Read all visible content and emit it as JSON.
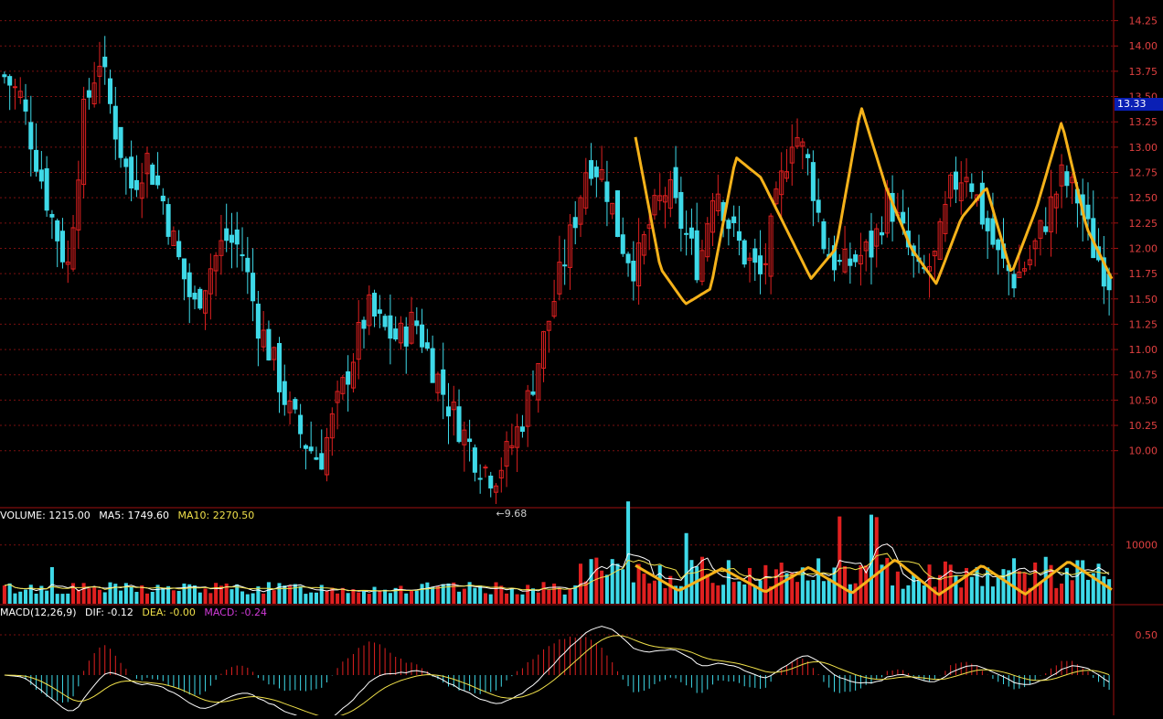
{
  "colors": {
    "up": "#e02020",
    "down": "#3ed9e8",
    "axis": "#a01010",
    "grid": "#7a1010",
    "highlight_line": "#f5b21a",
    "ma5": "#ffffff",
    "ma10": "#f0e04a",
    "macd_label": "#d03ad8",
    "price_tag_bg": "#0a1fb5"
  },
  "price_panel": {
    "current_price_tag": "13.33",
    "low_marker": "9.68",
    "y_ticks": [
      "14.25",
      "14.00",
      "13.75",
      "13.50",
      "13.25",
      "13.00",
      "12.75",
      "12.50",
      "12.25",
      "12.00",
      "11.75",
      "11.50",
      "11.25",
      "11.00",
      "10.75",
      "10.50",
      "10.25",
      "10.00"
    ]
  },
  "volume_panel": {
    "legend": {
      "volume_label": "VOLUME: 1215.00",
      "ma5_label": "MA5: 1749.60",
      "ma10_label": "MA10: 2270.50"
    },
    "y_ticks": [
      "10000"
    ]
  },
  "macd_panel": {
    "legend": {
      "title": "MACD(12,26,9)",
      "dif_label": "DIF: -0.12",
      "dea_label": "DEA: -0.00",
      "macd_label": "MACD: -0.24"
    },
    "y_ticks": [
      "0.50"
    ]
  },
  "chart_data": {
    "type": "candlestick",
    "y_range": [
      9.5,
      14.4
    ],
    "bar_count": 210,
    "close_path": [
      13.7,
      13.5,
      12.9,
      12.3,
      11.8,
      13.3,
      13.9,
      13.2,
      12.6,
      12.9,
      12.5,
      11.9,
      11.4,
      11.8,
      12.1,
      12.0,
      11.3,
      10.9,
      10.4,
      10.1,
      9.9,
      10.4,
      10.9,
      11.4,
      11.2,
      11.1,
      11.3,
      10.9,
      10.5,
      10.2,
      9.9,
      9.75,
      10.0,
      10.4,
      11.0,
      11.6,
      12.2,
      12.9,
      12.7,
      12.1,
      11.8,
      12.3,
      12.6,
      12.2,
      11.8,
      12.7,
      12.2,
      11.9,
      11.7,
      12.5,
      13.2,
      12.8,
      12.0,
      11.8,
      11.9,
      12.0,
      12.5,
      12.1,
      11.7,
      11.9,
      12.6,
      12.8,
      12.3,
      11.9,
      11.7,
      11.9,
      12.3,
      12.7,
      12.5,
      12.0,
      11.7
    ],
    "highlight_curve": [
      13.1,
      11.8,
      11.45,
      11.6,
      12.9,
      12.7,
      12.2,
      11.7,
      12.0,
      13.4,
      12.6,
      12.0,
      11.65,
      12.3,
      12.6,
      11.75,
      12.4,
      13.25,
      12.2,
      11.7
    ],
    "volume_range": [
      0,
      14000
    ],
    "macd_range": [
      -0.75,
      0.75
    ]
  }
}
